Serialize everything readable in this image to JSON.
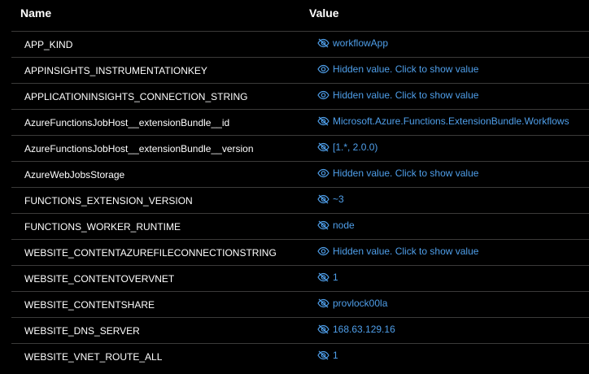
{
  "header": {
    "name_label": "Name",
    "value_label": "Value"
  },
  "accent_color": "#4f9fea",
  "rows": [
    {
      "name": "APP_KIND",
      "value": "workflowApp",
      "icon": "eye-slash-icon"
    },
    {
      "name": "APPINSIGHTS_INSTRUMENTATIONKEY",
      "value": "Hidden value. Click to show value",
      "icon": "eye-icon"
    },
    {
      "name": "APPLICATIONINSIGHTS_CONNECTION_STRING",
      "value": "Hidden value. Click to show value",
      "icon": "eye-icon"
    },
    {
      "name": "AzureFunctionsJobHost__extensionBundle__id",
      "value": "Microsoft.Azure.Functions.ExtensionBundle.Workflows",
      "icon": "eye-slash-icon"
    },
    {
      "name": "AzureFunctionsJobHost__extensionBundle__version",
      "value": "[1.*, 2.0.0)",
      "icon": "eye-slash-icon"
    },
    {
      "name": "AzureWebJobsStorage",
      "value": "Hidden value. Click to show value",
      "icon": "eye-icon"
    },
    {
      "name": "FUNCTIONS_EXTENSION_VERSION",
      "value": "~3",
      "icon": "eye-slash-icon"
    },
    {
      "name": "FUNCTIONS_WORKER_RUNTIME",
      "value": "node",
      "icon": "eye-slash-icon"
    },
    {
      "name": "WEBSITE_CONTENTAZUREFILECONNECTIONSTRING",
      "value": "Hidden value. Click to show value",
      "icon": "eye-icon"
    },
    {
      "name": "WEBSITE_CONTENTOVERVNET",
      "value": "1",
      "icon": "eye-slash-icon"
    },
    {
      "name": "WEBSITE_CONTENTSHARE",
      "value": "provlock00la",
      "icon": "eye-slash-icon"
    },
    {
      "name": "WEBSITE_DNS_SERVER",
      "value": "168.63.129.16",
      "icon": "eye-slash-icon"
    },
    {
      "name": "WEBSITE_VNET_ROUTE_ALL",
      "value": "1",
      "icon": "eye-slash-icon"
    }
  ]
}
